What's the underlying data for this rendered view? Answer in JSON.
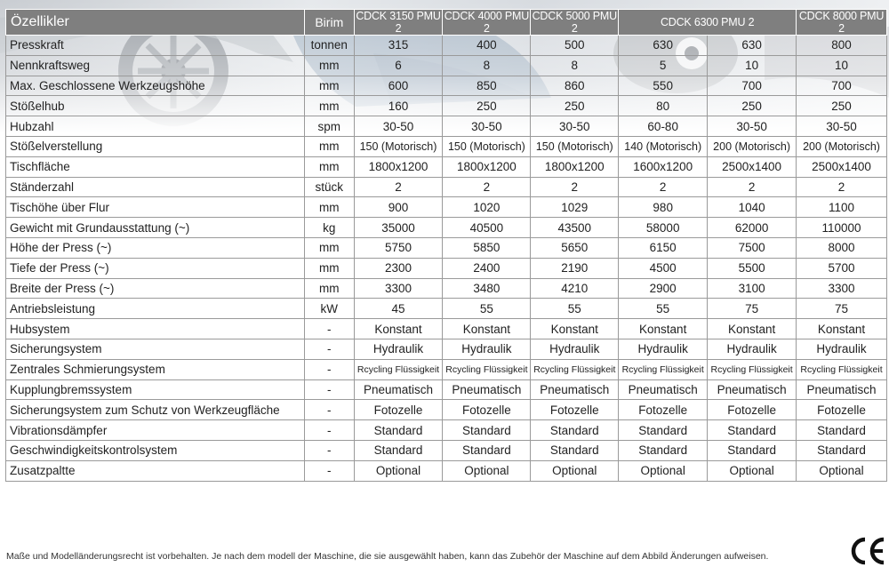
{
  "table": {
    "header": {
      "feature": "Özellikler",
      "unit": "Birim",
      "models": [
        {
          "label": "CDCK 3150 PMU 2",
          "span": 1
        },
        {
          "label": "CDCK 4000 PMU 2",
          "span": 1
        },
        {
          "label": "CDCK 5000 PMU 2",
          "span": 1
        },
        {
          "label": "CDCK 6300 PMU 2",
          "span": 2
        },
        {
          "label": "CDCK 8000 PMU 2",
          "span": 1
        }
      ]
    },
    "rows": [
      {
        "feature": "Presskraft",
        "unit": "tonnen",
        "values": [
          "315",
          "400",
          "500",
          "630",
          "630",
          "800"
        ]
      },
      {
        "feature": "Nennkraftsweg",
        "unit": "mm",
        "values": [
          "6",
          "8",
          "8",
          "5",
          "10",
          "10"
        ]
      },
      {
        "feature": "Max. Geschlossene Werkzeugshöhe",
        "unit": "mm",
        "values": [
          "600",
          "850",
          "860",
          "550",
          "700",
          "700"
        ]
      },
      {
        "feature": "Stößelhub",
        "unit": "mm",
        "values": [
          "160",
          "250",
          "250",
          "80",
          "250",
          "250"
        ]
      },
      {
        "feature": "Hubzahl",
        "unit": "spm",
        "values": [
          "30-50",
          "30-50",
          "30-50",
          "60-80",
          "30-50",
          "30-50"
        ]
      },
      {
        "feature": "Stößelverstellung",
        "unit": "mm",
        "values": [
          "150 (Motorisch)",
          "150 (Motorisch)",
          "150 (Motorisch)",
          "140 (Motorisch)",
          "200 (Motorisch)",
          "200 (Motorisch)"
        ]
      },
      {
        "feature": "Tischfläche",
        "unit": "mm",
        "values": [
          "1800x1200",
          "1800x1200",
          "1800x1200",
          "1600x1200",
          "2500x1400",
          "2500x1400"
        ]
      },
      {
        "feature": "Ständerzahl",
        "unit": "stück",
        "values": [
          "2",
          "2",
          "2",
          "2",
          "2",
          "2"
        ]
      },
      {
        "feature": "Tischöhe über Flur",
        "unit": "mm",
        "values": [
          "900",
          "1020",
          "1029",
          "980",
          "1040",
          "1100"
        ]
      },
      {
        "feature": "Gewicht mit Grundausstattung  (~)",
        "unit": "kg",
        "values": [
          "35000",
          "40500",
          "43500",
          "58000",
          "62000",
          "110000"
        ]
      },
      {
        "feature": "Höhe der Press  (~)",
        "unit": "mm",
        "values": [
          "5750",
          "5850",
          "5650",
          "6150",
          "7500",
          "8000"
        ]
      },
      {
        "feature": "Tiefe der Press   (~)",
        "unit": "mm",
        "values": [
          "2300",
          "2400",
          "2190",
          "4500",
          "5500",
          "5700"
        ]
      },
      {
        "feature": "Breite der Press   (~)",
        "unit": "mm",
        "values": [
          "3300",
          "3480",
          "4210",
          "2900",
          "3100",
          "3300"
        ]
      },
      {
        "feature": "Antriebsleistung",
        "unit": "kW",
        "values": [
          "45",
          "55",
          "55",
          "55",
          "75",
          "75"
        ]
      },
      {
        "feature": "Hubsystem",
        "unit": "-",
        "values": [
          "Konstant",
          "Konstant",
          "Konstant",
          "Konstant",
          "Konstant",
          "Konstant"
        ]
      },
      {
        "feature": "Sicherungsystem",
        "unit": "-",
        "values": [
          "Hydraulik",
          "Hydraulik",
          "Hydraulik",
          "Hydraulik",
          "Hydraulik",
          "Hydraulik"
        ]
      },
      {
        "feature": "Zentrales Schmierungsystem",
        "unit": "-",
        "values": [
          "Rcycling Flüssigkeit",
          "Rcycling Flüssigkeit",
          "Rcycling Flüssigkeit",
          "Rcycling Flüssigkeit",
          "Rcycling Flüssigkeit",
          "Rcycling Flüssigkeit"
        ]
      },
      {
        "feature": "Kupplungbremssystem",
        "unit": "-",
        "values": [
          "Pneumatisch",
          "Pneumatisch",
          "Pneumatisch",
          "Pneumatisch",
          "Pneumatisch",
          "Pneumatisch"
        ]
      },
      {
        "feature": "Sicherungsystem  zum Schutz von Werkzeugfläche",
        "unit": "-",
        "values": [
          "Fotozelle",
          "Fotozelle",
          "Fotozelle",
          "Fotozelle",
          "Fotozelle",
          "Fotozelle"
        ]
      },
      {
        "feature": "Vibrationsdämpfer",
        "unit": "-",
        "values": [
          "Standard",
          "Standard",
          "Standard",
          "Standard",
          "Standard",
          "Standard"
        ]
      },
      {
        "feature": "Geschwindigkeitskontrolsystem",
        "unit": "-",
        "values": [
          "Standard",
          "Standard",
          "Standard",
          "Standard",
          "Standard",
          "Standard"
        ]
      },
      {
        "feature": "Zusatzpaltte",
        "unit": "-",
        "values": [
          "Optional",
          "Optional",
          "Optional",
          "Optional",
          "Optional",
          "Optional"
        ]
      }
    ]
  },
  "footer": {
    "note": "Maße und Modelländerungsrecht ist vorbehalten. Je nach dem modell der Maschine, die sie ausgewählt haben, kann das Zubehör der Maschine auf dem Abbild Änderungen aufweisen.",
    "mark": "CE"
  }
}
